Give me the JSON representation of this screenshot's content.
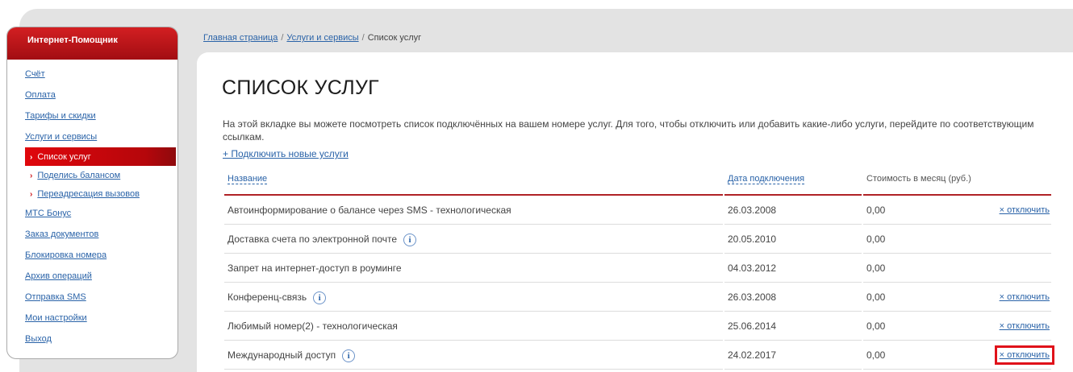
{
  "sidebar": {
    "title": "Интернет-Помощник",
    "items": [
      {
        "label": "Счёт"
      },
      {
        "label": "Оплата"
      },
      {
        "label": "Тарифы и скидки"
      },
      {
        "label": "Услуги и сервисы"
      },
      {
        "label": "Список услуг",
        "sub": true,
        "active": true
      },
      {
        "label": "Поделись балансом",
        "sub": true
      },
      {
        "label": "Переадресация вызовов",
        "sub": true
      },
      {
        "label": "МТС Бонус"
      },
      {
        "label": "Заказ документов"
      },
      {
        "label": "Блокировка номера"
      },
      {
        "label": "Архив операций"
      },
      {
        "label": "Отправка SMS"
      },
      {
        "label": "Мои настройки"
      },
      {
        "label": "Выход"
      }
    ],
    "sub_arrow": "›"
  },
  "breadcrumb": {
    "home": "Главная страница",
    "services": "Услуги и сервисы",
    "current": "Список услуг",
    "separator": "/"
  },
  "main": {
    "title": "СПИСОК УСЛУГ",
    "intro": "На этой вкладке вы можете посмотреть список подключённых на вашем номере услуг. Для того, чтобы отключить или добавить какие-либо услуги, перейдите по соответствующим ссылкам.",
    "add_link": "+ Подключить новые услуги"
  },
  "table": {
    "headers": {
      "name": "Название",
      "date": "Дата подключения",
      "cost": "Стоимость в месяц (руб.)"
    },
    "info_glyph": "i",
    "rows": [
      {
        "name": "Автоинформирование о балансе через SMS - технологическая",
        "info": false,
        "date": "26.03.2008",
        "cost": "0,00",
        "action": "× отключить"
      },
      {
        "name": "Доставка счета по электронной почте",
        "info": true,
        "date": "20.05.2010",
        "cost": "0,00",
        "action": ""
      },
      {
        "name": "Запрет на интернет-доступ в роуминге",
        "info": false,
        "date": "04.03.2012",
        "cost": "0,00",
        "action": ""
      },
      {
        "name": "Конференц-связь",
        "info": true,
        "date": "26.03.2008",
        "cost": "0,00",
        "action": "× отключить"
      },
      {
        "name": "Любимый номер(2) - технологическая",
        "info": false,
        "date": "25.06.2014",
        "cost": "0,00",
        "action": "× отключить"
      },
      {
        "name": "Международный доступ",
        "info": true,
        "date": "24.02.2017",
        "cost": "0,00",
        "action": "× отключить",
        "highlight": true
      }
    ]
  },
  "colors": {
    "accent": "#d31f22",
    "link": "#2a63a8",
    "highlight": "#e0121a"
  }
}
